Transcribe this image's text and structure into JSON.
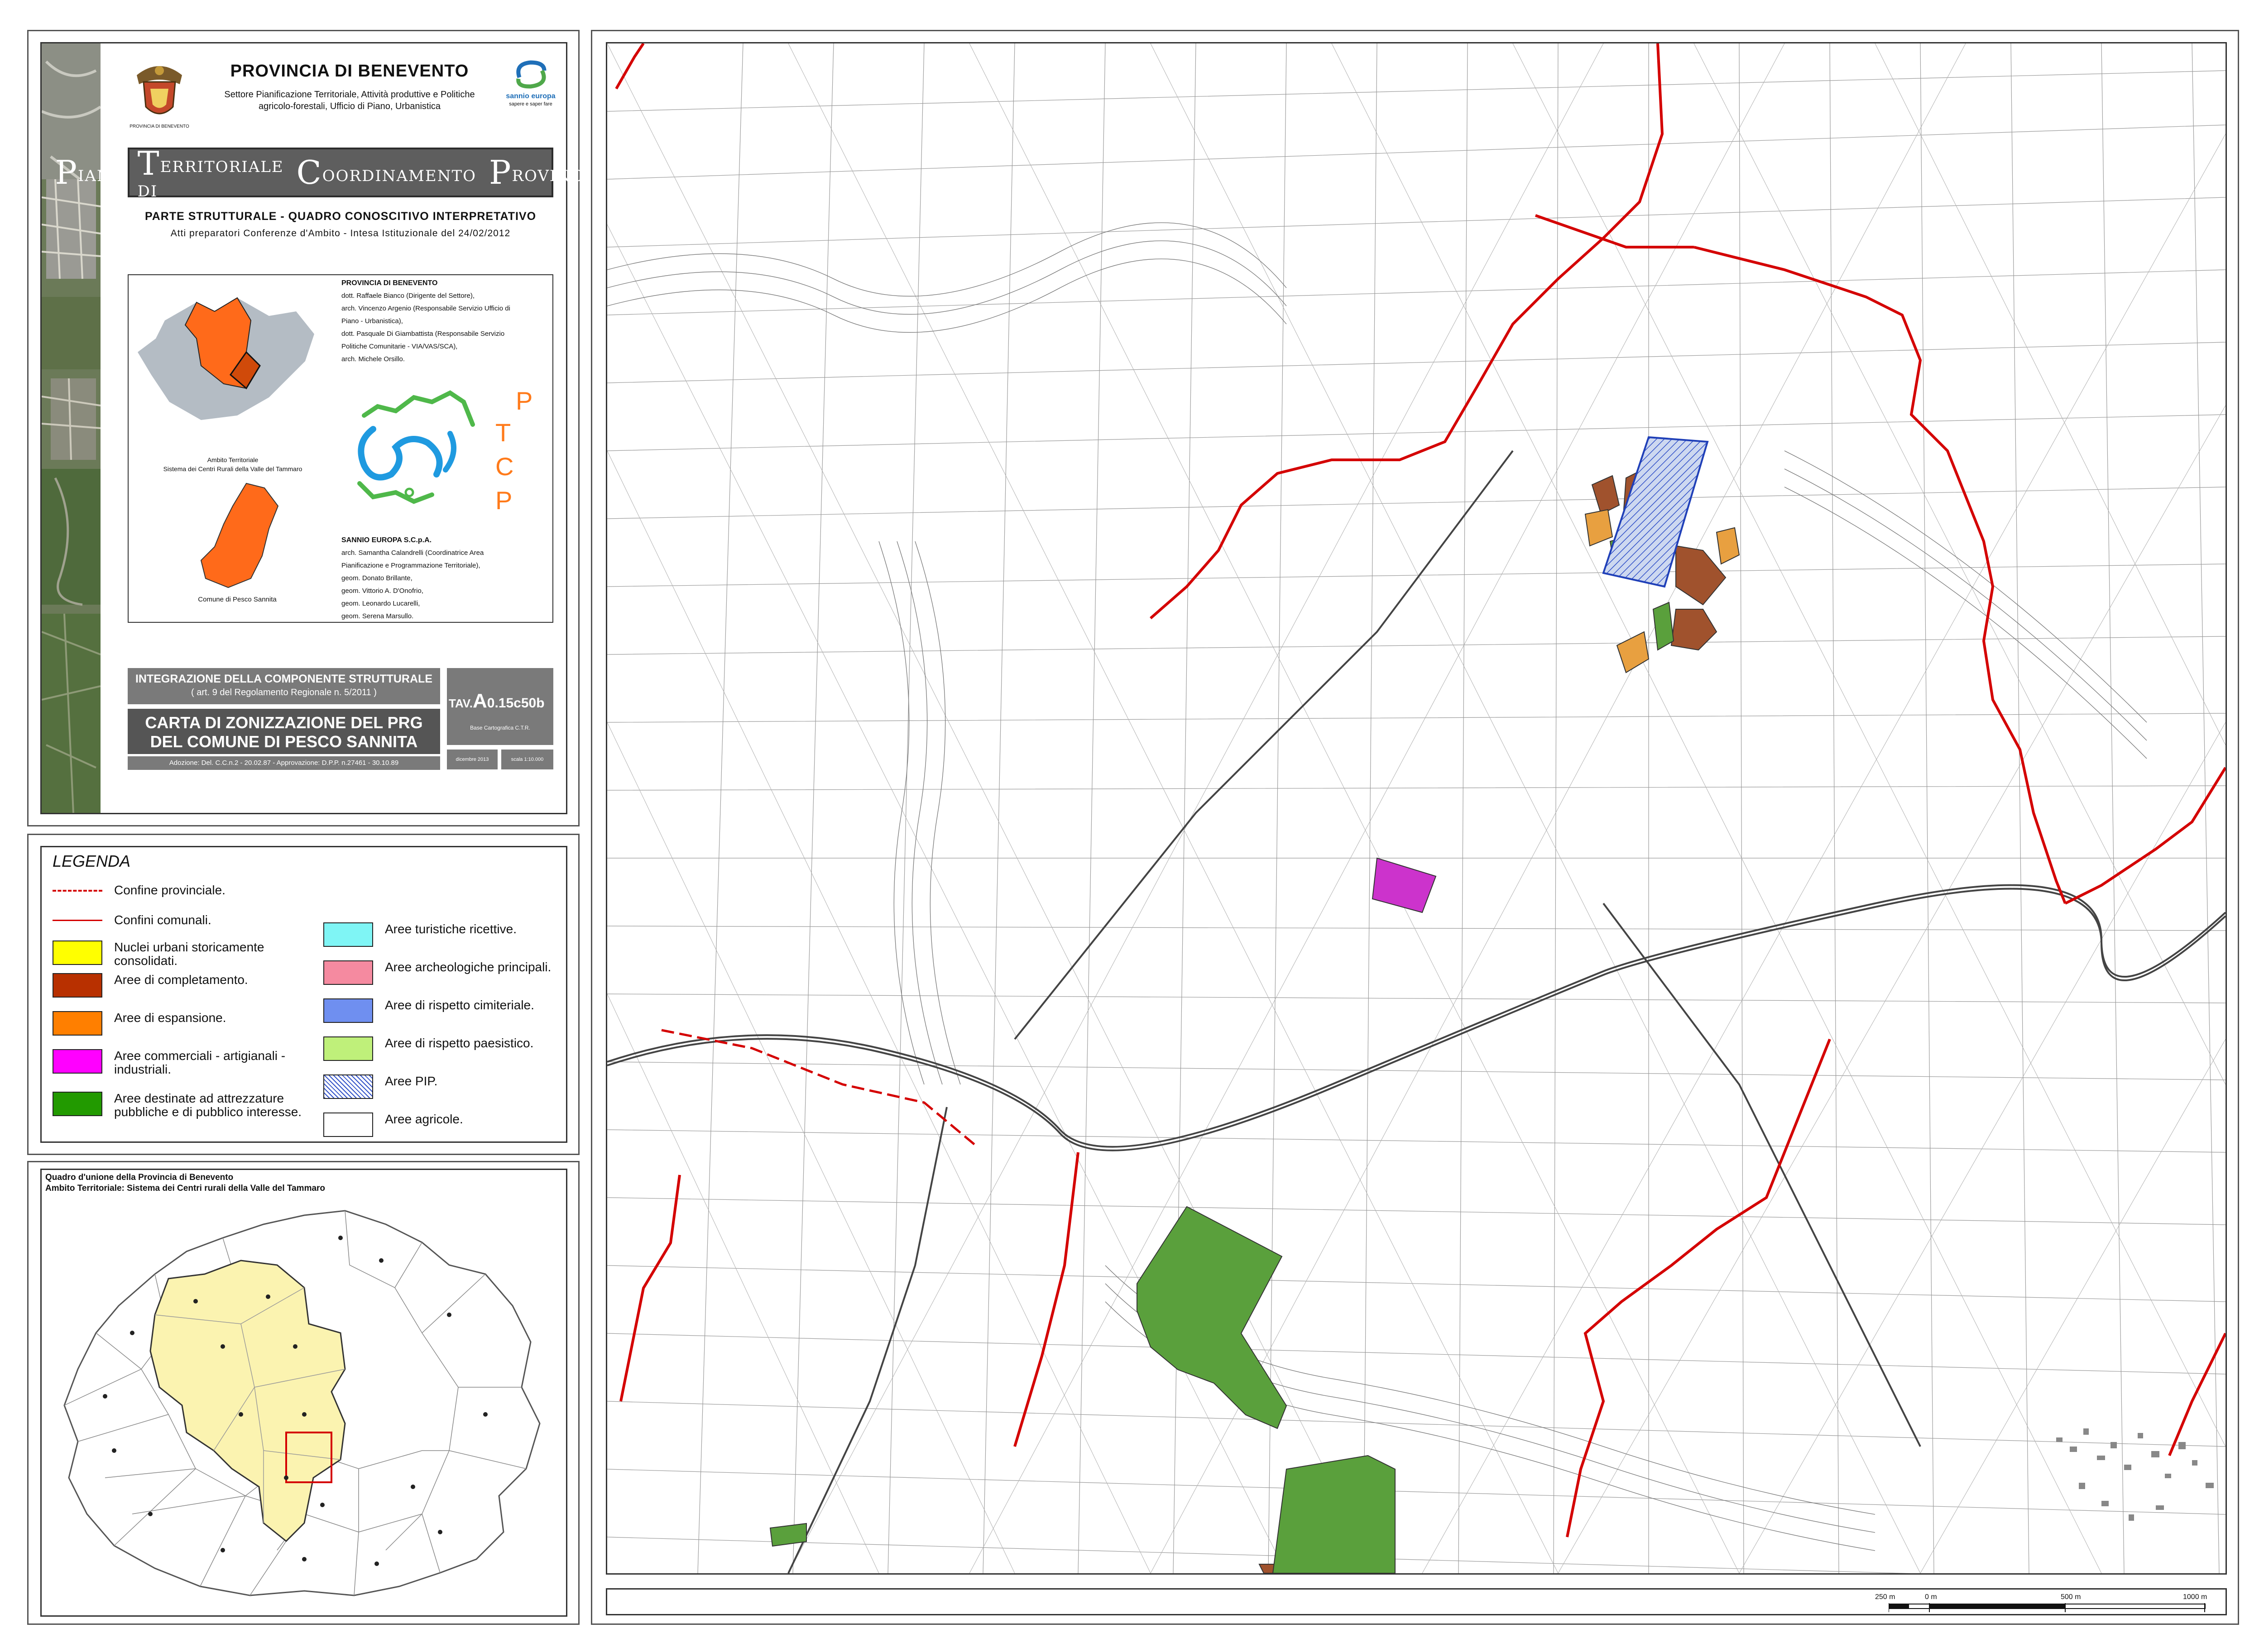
{
  "title_block": {
    "province": "PROVINCIA DI BENEVENTO",
    "logo_caption": "PROVINCIA DI BENEVENTO",
    "department_line1": "Settore Pianificazione Territoriale, Attività produttive e Politiche",
    "department_line2": "agricolo-forestali, Ufficio di Piano, Urbanistica",
    "partner_logo_name": "sannio europa",
    "partner_logo_tag": "sapere e saper fare",
    "plan_title": {
      "w1_cap": "P",
      "w1_rest": "IANO",
      "w2_cap": "T",
      "w2_rest": "ERRITORIALE DI",
      "w3_cap": "C",
      "w3_rest": "OORDINAMENTO",
      "w4_cap": "P",
      "w4_rest": "ROVINCIALE"
    },
    "section": "PARTE STRUTTURALE - QUADRO CONOSCITIVO INTERPRETATIVO",
    "acts": "Atti preparatori Conferenze d'Ambito - Intesa Istituzionale del 24/02/2012",
    "ambit_caption_line1": "Ambito Territoriale",
    "ambit_caption_line2": "Sistema dei Centri Rurali della Valle del Tammaro",
    "comune_caption": "Comune di Pesco Sannita",
    "credits": {
      "heading1": "PROVINCIA DI BENEVENTO",
      "lines1": [
        "dott. Raffaele Bianco (Dirigente del Settore),",
        "arch. Vincenzo Argenio (Responsabile Servizio Ufficio di",
        "Piano - Urbanistica),",
        "dott. Pasquale Di Giambattista (Responsabile Servizio",
        "Politiche Comunitarie - VIA/VAS/SCA),",
        "arch. Michele Orsillo."
      ],
      "heading2": "SANNIO EUROPA S.C.p.A.",
      "lines2": [
        "arch. Samantha Calandrelli (Coordinatrice Area",
        "Pianificazione e Programmazione Territoriale),",
        "geom. Donato Brillante,",
        "geom. Vittorio A. D'Onofrio,",
        "geom. Leonardo Lucarelli,",
        "geom. Serena Marsullo."
      ]
    },
    "ptcp_letters": [
      "P",
      "T",
      "C",
      "P"
    ],
    "integration_line1": "INTEGRAZIONE DELLA COMPONENTE STRUTTURALE",
    "integration_line2": "( art. 9 del Regolamento Regionale n. 5/2011 )",
    "map_title_line1": "CARTA DI ZONIZZAZIONE DEL PRG",
    "map_title_line2": "DEL COMUNE DI PESCO SANNITA",
    "adoption": "Adozione: Del. C.C.n.2 - 20.02.87 - Approvazione: D.P.P. n.27461 - 30.10.89",
    "tav_prefix": "TAV.",
    "tav_code_big": "A",
    "tav_code_rest": "0.15c50b",
    "base": "Base Cartografica C.T.R.",
    "date": "dicembre 2013",
    "scale": "scala 1:10.000"
  },
  "legend": {
    "title": "LEGENDA",
    "left": [
      {
        "kind": "line",
        "style": "dashed",
        "color": "#d40000",
        "label": "Confine provinciale."
      },
      {
        "kind": "line",
        "style": "solid",
        "color": "#d40000",
        "label": "Confini comunali."
      },
      {
        "kind": "fill",
        "color": "#ffff00",
        "label": "Nuclei urbani storicamente consolidati."
      },
      {
        "kind": "fill",
        "color": "#b83000",
        "label": "Aree di completamento."
      },
      {
        "kind": "fill",
        "color": "#ff7f00",
        "label": "Aree di espansione."
      },
      {
        "kind": "fill",
        "color": "#ff00ff",
        "label": "Aree commerciali - artigianali - industriali."
      },
      {
        "kind": "fill",
        "color": "#229a00",
        "label": "Aree destinate ad attrezzature pubbliche e di pubblico interesse."
      }
    ],
    "right": [
      {
        "kind": "fill",
        "color": "#7ff5f5",
        "label": "Aree turistiche ricettive."
      },
      {
        "kind": "fill",
        "color": "#f58aa0",
        "label": "Aree archeologiche principali."
      },
      {
        "kind": "fill",
        "color": "#6f8ff0",
        "label": "Aree di rispetto cimiteriale."
      },
      {
        "kind": "fill",
        "color": "#bff07a",
        "label": "Aree di rispetto paesistico."
      },
      {
        "kind": "hatch",
        "color": "#3050c8",
        "label": "Aree PIP."
      },
      {
        "kind": "fill",
        "color": "#ffffff",
        "label": "Aree agricole."
      }
    ]
  },
  "overview": {
    "line1": "Quadro d'unione della Provincia di Benevento",
    "line2": "Ambito Territoriale: Sistema dei Centri rurali della Valle del Tammaro"
  },
  "scale_bar": {
    "labels": [
      "250 m",
      "0 m",
      "500 m",
      "1000 m"
    ]
  },
  "colors": {
    "boundary": "#d40000",
    "completamento": "#a0522d",
    "espansione": "#e8a040",
    "commerciale": "#cc33cc",
    "attrezzature": "#5aa03c",
    "pip": "#3050c8",
    "ambit_fill": "#ff6a1a",
    "province_fill": "#b4bcc4",
    "overview_ambit": "#fbf3b0"
  }
}
